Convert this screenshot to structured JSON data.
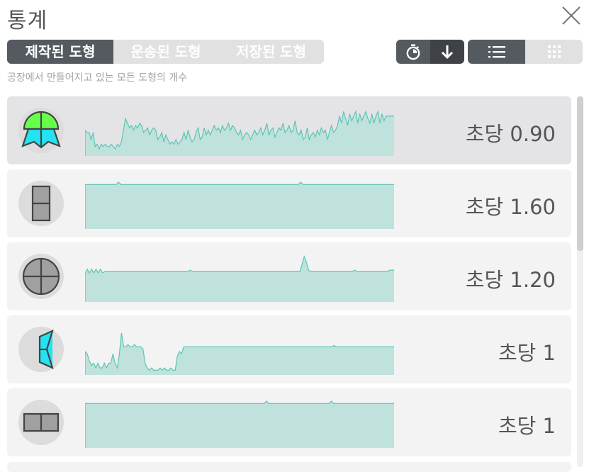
{
  "header": {
    "title": "통계"
  },
  "tabs": [
    {
      "label": "제작된 도형",
      "active": true
    },
    {
      "label": "운송된 도형",
      "active": false
    },
    {
      "label": "저장된 도형",
      "active": false
    }
  ],
  "subtitle": "공장에서 만들어지고 있는 모든 도형의 개수",
  "toolbar": {
    "icons": [
      "stopwatch-icon",
      "arrow-down-icon",
      "list-view-icon",
      "grid-view-icon"
    ]
  },
  "colors": {
    "accent_dark": "#555a60",
    "graph_fill": "#bfe2dc",
    "graph_line": "#5cc5b3",
    "row_bg": "#f3f3f3",
    "row_selected_bg": "#e4e4e7"
  },
  "rows": [
    {
      "shape": "umbrella-green-cyan-shape-icon",
      "rate": "초당 0.90",
      "values": [
        0.55,
        0.5,
        0.5,
        0.35,
        0.5,
        0.2,
        0.25,
        0.15,
        0.25,
        0.2,
        0.25,
        0.2,
        0.2,
        0.25,
        0.2,
        0.15,
        0.25,
        0.2,
        0.3,
        0.55,
        0.8,
        0.7,
        0.6,
        0.65,
        0.55,
        0.65,
        0.6,
        0.7,
        0.65,
        0.5,
        0.55,
        0.6,
        0.45,
        0.55,
        0.6,
        0.55,
        0.35,
        0.4,
        0.5,
        0.3,
        0.45,
        0.35,
        0.25,
        0.3,
        0.25,
        0.35,
        0.25,
        0.3,
        0.35,
        0.5,
        0.35,
        0.55,
        0.4,
        0.3,
        0.35,
        0.5,
        0.6,
        0.35,
        0.4,
        0.6,
        0.45,
        0.55,
        0.45,
        0.55,
        0.65,
        0.55,
        0.6,
        0.5,
        0.65,
        0.55,
        0.6,
        0.7,
        0.55,
        0.65,
        0.6,
        0.5,
        0.45,
        0.55,
        0.35,
        0.45,
        0.5,
        0.45,
        0.35,
        0.45,
        0.55,
        0.45,
        0.5,
        0.6,
        0.45,
        0.55,
        0.7,
        0.45,
        0.55,
        0.6,
        0.4,
        0.5,
        0.6,
        0.55,
        0.7,
        0.5,
        0.55,
        0.65,
        0.5,
        0.55,
        0.75,
        0.5,
        0.45,
        0.55,
        0.35,
        0.4,
        0.6,
        0.35,
        0.45,
        0.5,
        0.4,
        0.55,
        0.45,
        0.6,
        0.5,
        0.55,
        0.35,
        0.5,
        0.65,
        0.5,
        0.55,
        0.65,
        0.85,
        0.7,
        0.95,
        0.8,
        0.65,
        0.9,
        0.75,
        0.85,
        0.95,
        0.7,
        0.9,
        0.75,
        0.85,
        0.95,
        0.8,
        0.7,
        0.9,
        0.7,
        0.85,
        0.95,
        0.7,
        0.9,
        0.75,
        0.85,
        0.85,
        0.85,
        0.85,
        0.85
      ],
      "selected": true
    },
    {
      "shape": "split-rectangle-vertical-shape-icon",
      "rate": "초당 1.60",
      "values": [
        0.95,
        0.95,
        0.95,
        0.95,
        0.95,
        0.95,
        0.95,
        0.95,
        0.95,
        0.95,
        0.95,
        0.95,
        0.95,
        0.95,
        1.0,
        0.95,
        0.95,
        0.95,
        0.95,
        0.95,
        0.95,
        0.95,
        0.95,
        0.95,
        0.95,
        0.95,
        0.95,
        0.95,
        0.95,
        0.95,
        0.95,
        0.95,
        0.95,
        0.95,
        0.95,
        0.95,
        0.95,
        0.95,
        0.95,
        0.95,
        0.95,
        0.95,
        0.95,
        0.95,
        0.95,
        0.95,
        0.95,
        0.95,
        0.95,
        0.95,
        0.95,
        0.95,
        0.95,
        0.95,
        0.95,
        0.95,
        0.95,
        0.95,
        0.95,
        0.95,
        0.95,
        0.95,
        0.95,
        0.95,
        0.95,
        0.95,
        0.95,
        0.95,
        0.95,
        0.95,
        0.95,
        0.95,
        0.95,
        0.95,
        0.95,
        0.95,
        0.95,
        0.95,
        0.95,
        0.95,
        0.95,
        0.95,
        0.95,
        0.95,
        0.95,
        0.95,
        0.95,
        0.95,
        0.95,
        0.95,
        1.0,
        0.95,
        0.95,
        0.95,
        0.95,
        0.95,
        0.95,
        0.95,
        0.95,
        0.95,
        0.95,
        0.95,
        0.95,
        0.95,
        0.95,
        0.95,
        0.95,
        0.95,
        0.95,
        0.95,
        0.95,
        0.95,
        0.95,
        0.95,
        0.95,
        0.95,
        0.95,
        0.95,
        0.95,
        0.95,
        0.95,
        0.95,
        0.95,
        0.95,
        0.95,
        0.95,
        0.95,
        0.95,
        0.95,
        0.95
      ],
      "selected": false
    },
    {
      "shape": "circle-quarters-grey-shape-icon",
      "rate": "초당 1.20",
      "values": [
        0.6,
        0.7,
        0.62,
        0.7,
        0.62,
        0.7,
        0.62,
        0.7,
        0.62,
        0.65,
        0.65,
        0.65,
        0.65,
        0.65,
        0.65,
        0.65,
        0.65,
        0.65,
        0.65,
        0.65,
        0.65,
        0.65,
        0.65,
        0.65,
        0.65,
        0.65,
        0.65,
        0.65,
        0.65,
        0.65,
        0.65,
        0.65,
        0.65,
        0.65,
        0.65,
        0.65,
        0.65,
        0.65,
        0.65,
        0.65,
        0.65,
        0.65,
        0.65,
        0.65,
        0.65,
        0.65,
        0.65,
        0.65,
        0.68,
        0.65,
        0.65,
        0.65,
        0.65,
        0.65,
        0.65,
        0.65,
        0.65,
        0.65,
        0.65,
        0.65,
        0.65,
        0.65,
        0.65,
        0.65,
        0.65,
        0.65,
        0.65,
        0.65,
        0.65,
        0.65,
        0.65,
        0.65,
        0.65,
        0.65,
        0.65,
        0.65,
        0.65,
        0.65,
        0.65,
        0.65,
        0.65,
        0.65,
        0.65,
        0.65,
        0.65,
        0.65,
        0.65,
        0.65,
        0.65,
        0.65,
        0.65,
        0.65,
        0.65,
        0.65,
        0.65,
        0.65,
        0.65,
        0.65,
        0.65,
        0.8,
        0.97,
        0.85,
        0.68,
        0.65,
        0.65,
        0.65,
        0.65,
        0.65,
        0.65,
        0.65,
        0.65,
        0.65,
        0.65,
        0.65,
        0.65,
        0.65,
        0.65,
        0.65,
        0.65,
        0.65,
        0.65,
        0.65,
        0.65,
        0.68,
        0.65,
        0.65,
        0.65,
        0.65,
        0.65,
        0.65,
        0.65,
        0.65,
        0.65,
        0.65,
        0.65,
        0.65,
        0.65,
        0.65,
        0.65,
        0.68,
        0.68,
        0.68
      ],
      "selected": false
    },
    {
      "shape": "cyan-chevron-shape-icon",
      "rate": "초당 1",
      "values": [
        0.5,
        0.45,
        0.3,
        0.2,
        0.25,
        0.15,
        0.25,
        0.15,
        0.15,
        0.25,
        0.15,
        0.25,
        0.25,
        0.45,
        0.25,
        0.15,
        0.45,
        0.9,
        0.6,
        0.6,
        0.65,
        0.6,
        0.6,
        0.65,
        0.6,
        0.6,
        0.6,
        0.55,
        0.25,
        0.15,
        0.1,
        0.15,
        0.1,
        0.1,
        0.1,
        0.15,
        0.1,
        0.15,
        0.1,
        0.1,
        0.15,
        0.1,
        0.1,
        0.4,
        0.5,
        0.45,
        0.6,
        0.6,
        0.6,
        0.6,
        0.6,
        0.6,
        0.6,
        0.6,
        0.6,
        0.6,
        0.6,
        0.6,
        0.6,
        0.6,
        0.6,
        0.6,
        0.6,
        0.6,
        0.6,
        0.6,
        0.6,
        0.6,
        0.6,
        0.6,
        0.6,
        0.6,
        0.6,
        0.6,
        0.6,
        0.6,
        0.6,
        0.6,
        0.6,
        0.6,
        0.6,
        0.6,
        0.6,
        0.6,
        0.6,
        0.6,
        0.6,
        0.6,
        0.6,
        0.6,
        0.6,
        0.6,
        0.6,
        0.6,
        0.6,
        0.6,
        0.6,
        0.6,
        0.6,
        0.6,
        0.6,
        0.6,
        0.6,
        0.6,
        0.6,
        0.6,
        0.6,
        0.6,
        0.6,
        0.6,
        0.6,
        0.6,
        0.6,
        0.6,
        0.6,
        0.6,
        0.63,
        0.6,
        0.6,
        0.6,
        0.6,
        0.6,
        0.6,
        0.6,
        0.6,
        0.6,
        0.6,
        0.6,
        0.6,
        0.6,
        0.6,
        0.6,
        0.6,
        0.6,
        0.6,
        0.6,
        0.6,
        0.6,
        0.6,
        0.6,
        0.6,
        0.6,
        0.6,
        0.6,
        0.6
      ],
      "selected": false
    },
    {
      "shape": "split-rectangle-horizontal-shape-icon",
      "rate": "초당 1",
      "values": [
        0.95,
        0.95,
        0.95,
        0.95,
        0.95,
        0.95,
        0.95,
        0.95,
        0.95,
        0.95,
        0.95,
        0.95,
        0.95,
        0.95,
        0.95,
        0.95,
        0.95,
        0.95,
        0.95,
        0.95,
        0.95,
        0.95,
        0.95,
        0.95,
        0.95,
        0.95,
        0.95,
        0.95,
        0.95,
        0.95,
        0.95,
        0.95,
        0.95,
        0.95,
        0.95,
        0.95,
        0.95,
        0.95,
        0.95,
        0.95,
        0.95,
        0.95,
        0.95,
        0.95,
        0.95,
        0.95,
        0.95,
        0.95,
        0.95,
        0.95,
        0.95,
        0.95,
        0.95,
        0.95,
        0.95,
        0.95,
        0.95,
        0.95,
        0.95,
        0.95,
        0.95,
        0.95,
        0.95,
        0.95,
        0.95,
        0.95,
        0.95,
        0.95,
        0.95,
        0.95,
        0.95,
        0.95,
        0.95,
        0.95,
        0.95,
        0.95,
        0.95,
        0.95,
        0.95,
        0.95,
        0.95,
        1.0,
        0.95,
        0.95,
        0.95,
        0.95,
        0.95,
        0.95,
        0.95,
        0.95,
        0.95,
        0.95,
        0.95,
        0.95,
        0.95,
        0.95,
        0.95,
        0.95,
        0.95,
        0.95,
        0.95,
        0.95,
        0.95,
        0.95,
        0.95,
        0.95,
        0.95,
        0.95,
        0.95,
        0.95,
        1.0,
        0.95,
        0.95,
        0.95,
        0.95,
        0.95,
        0.95,
        0.95,
        0.95,
        0.95,
        0.95,
        0.95,
        0.95,
        0.95,
        0.95,
        0.95,
        0.95,
        0.95,
        0.95,
        0.95,
        0.95,
        0.95,
        0.95,
        0.95,
        0.95,
        0.95,
        0.95,
        0.95,
        0.95
      ],
      "selected": false
    }
  ]
}
